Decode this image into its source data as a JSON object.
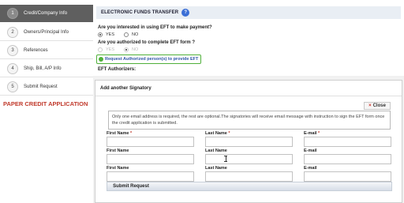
{
  "sidebar": {
    "steps": [
      {
        "num": "1",
        "label": "Credit/Company Info"
      },
      {
        "num": "2",
        "label": "Owners/Principal Info"
      },
      {
        "num": "3",
        "label": "References"
      },
      {
        "num": "4",
        "label": "Ship, Bill, A/P Info"
      },
      {
        "num": "5",
        "label": "Submit Request"
      }
    ],
    "paper_title": "PAPER CREDIT APPLICATION"
  },
  "eft": {
    "title": "ELECTRONIC FUNDS TRANSFER",
    "help": "?",
    "q1": "Are you interested in using EFT to make payment?",
    "q1_yes": "YES",
    "q1_no": "NO",
    "q2": "Are you authorized to complete EFT form ?",
    "q2_yes": "YES",
    "q2_no": "NO",
    "request_link": "Request Authorized person(s) to provide EFT",
    "authorizers_label": "EFT Authorizers:"
  },
  "modal": {
    "title": "Add another Signatory",
    "close_label": "Close",
    "close_x": "×",
    "info_text": "Only one email address is required, the rest are optional.The signatories will receive email message with instruction to sign the EFT form once the credit application is submitted.",
    "first_name": "First Name",
    "last_name": "Last Name",
    "email": "E-mail",
    "required_mark": "*",
    "submit_label": "Submit Request"
  },
  "colors": {
    "active_step_bg": "#5f5f5f",
    "accent_blue": "#3b6fd6",
    "link_green": "#4fb03a",
    "required_red": "#c0392b"
  }
}
